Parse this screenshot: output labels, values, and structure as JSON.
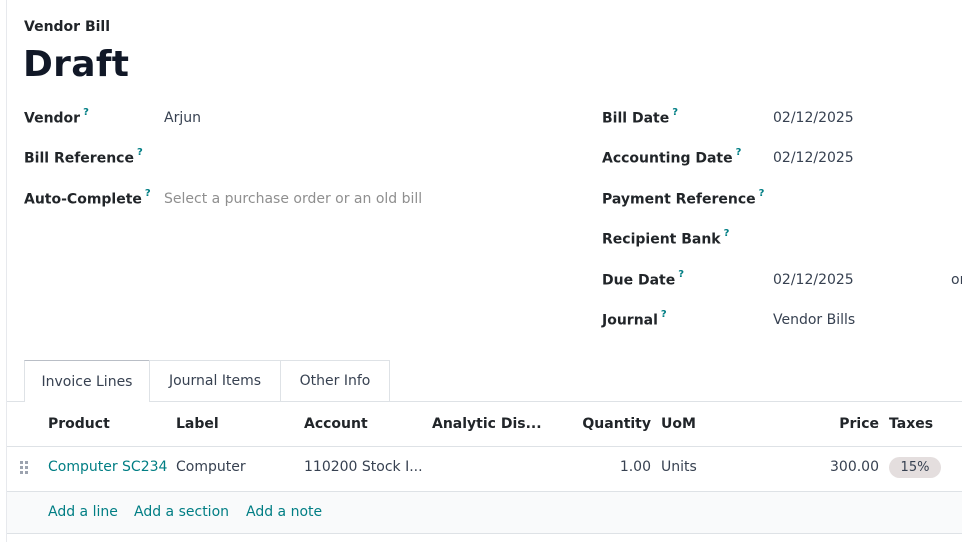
{
  "header": {
    "doc_type": "Vendor Bill",
    "state": "Draft"
  },
  "help_mark": "?",
  "left_fields": {
    "vendor_label": "Vendor",
    "vendor_value": "Arjun",
    "bill_reference_label": "Bill Reference",
    "bill_reference_value": "",
    "auto_complete_label": "Auto-Complete",
    "auto_complete_placeholder": "Select a purchase order or an old bill"
  },
  "right_fields": {
    "bill_date_label": "Bill Date",
    "bill_date_value": "02/12/2025",
    "accounting_date_label": "Accounting Date",
    "accounting_date_value": "02/12/2025",
    "payment_reference_label": "Payment Reference",
    "payment_reference_value": "",
    "recipient_bank_label": "Recipient Bank",
    "recipient_bank_value": "",
    "due_date_label": "Due Date",
    "due_date_value": "02/12/2025",
    "due_date_trailing": "or",
    "journal_label": "Journal",
    "journal_value": "Vendor Bills"
  },
  "tabs": [
    {
      "label": "Invoice Lines",
      "active": true
    },
    {
      "label": "Journal Items",
      "active": false
    },
    {
      "label": "Other Info",
      "active": false
    }
  ],
  "table": {
    "columns": [
      "Product",
      "Label",
      "Account",
      "Analytic Dis...",
      "Quantity",
      "UoM",
      "Price",
      "Taxes"
    ],
    "rows": [
      {
        "product": "Computer SC234",
        "label": "Computer",
        "account": "110200 Stock I...",
        "analytic": "",
        "quantity": "1.00",
        "uom": "Units",
        "price": "300.00",
        "tax": "15%"
      }
    ],
    "add_line": "Add a line",
    "add_section": "Add a section",
    "add_note": "Add a note"
  },
  "colors": {
    "accent": "#017e84",
    "tax_badge": "#e4dede"
  },
  "icons": {
    "drag_handle": "drag-handle-icon"
  }
}
